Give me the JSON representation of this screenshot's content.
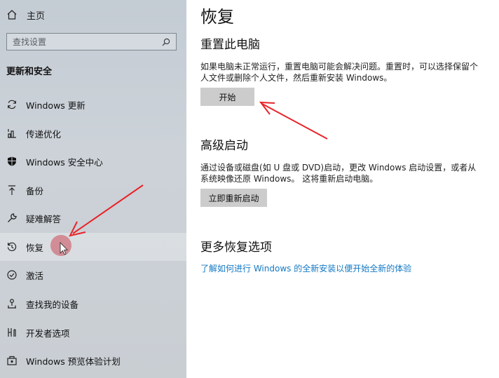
{
  "sidebar": {
    "home_label": "主页",
    "search_placeholder": "查找设置",
    "section_title": "更新和安全",
    "items": [
      {
        "label": "Windows 更新",
        "icon": "sync-icon"
      },
      {
        "label": "传递优化",
        "icon": "delivery-optimization-icon"
      },
      {
        "label": "Windows 安全中心",
        "icon": "shield-icon"
      },
      {
        "label": "备份",
        "icon": "backup-arrow-icon"
      },
      {
        "label": "疑难解答",
        "icon": "wrench-icon"
      },
      {
        "label": "恢复",
        "icon": "recovery-icon",
        "selected": true
      },
      {
        "label": "激活",
        "icon": "check-circle-icon"
      },
      {
        "label": "查找我的设备",
        "icon": "find-device-icon"
      },
      {
        "label": "开发者选项",
        "icon": "developer-icon"
      },
      {
        "label": "Windows 预览体验计划",
        "icon": "insider-icon"
      }
    ]
  },
  "main": {
    "title": "恢复",
    "reset": {
      "heading": "重置此电脑",
      "description": "如果电脑未正常运行，重置电脑可能会解决问题。重置时，可以选择保留个人文件或删除个人文件，然后重新安装 Windows。",
      "button": "开始"
    },
    "advanced": {
      "heading": "高级启动",
      "description": "通过设备或磁盘(如 U 盘或 DVD)启动，更改 Windows 启动设置，或者从系统映像还原 Windows。 这将重新启动电脑。",
      "button": "立即重新启动"
    },
    "more": {
      "heading": "更多恢复选项",
      "link": "了解如何进行 Windows 的全新安装以便开始全新的体验"
    }
  },
  "colors": {
    "annotation_arrow": "#e8242a",
    "link": "#1479c4",
    "button_bg": "#cccccc"
  }
}
